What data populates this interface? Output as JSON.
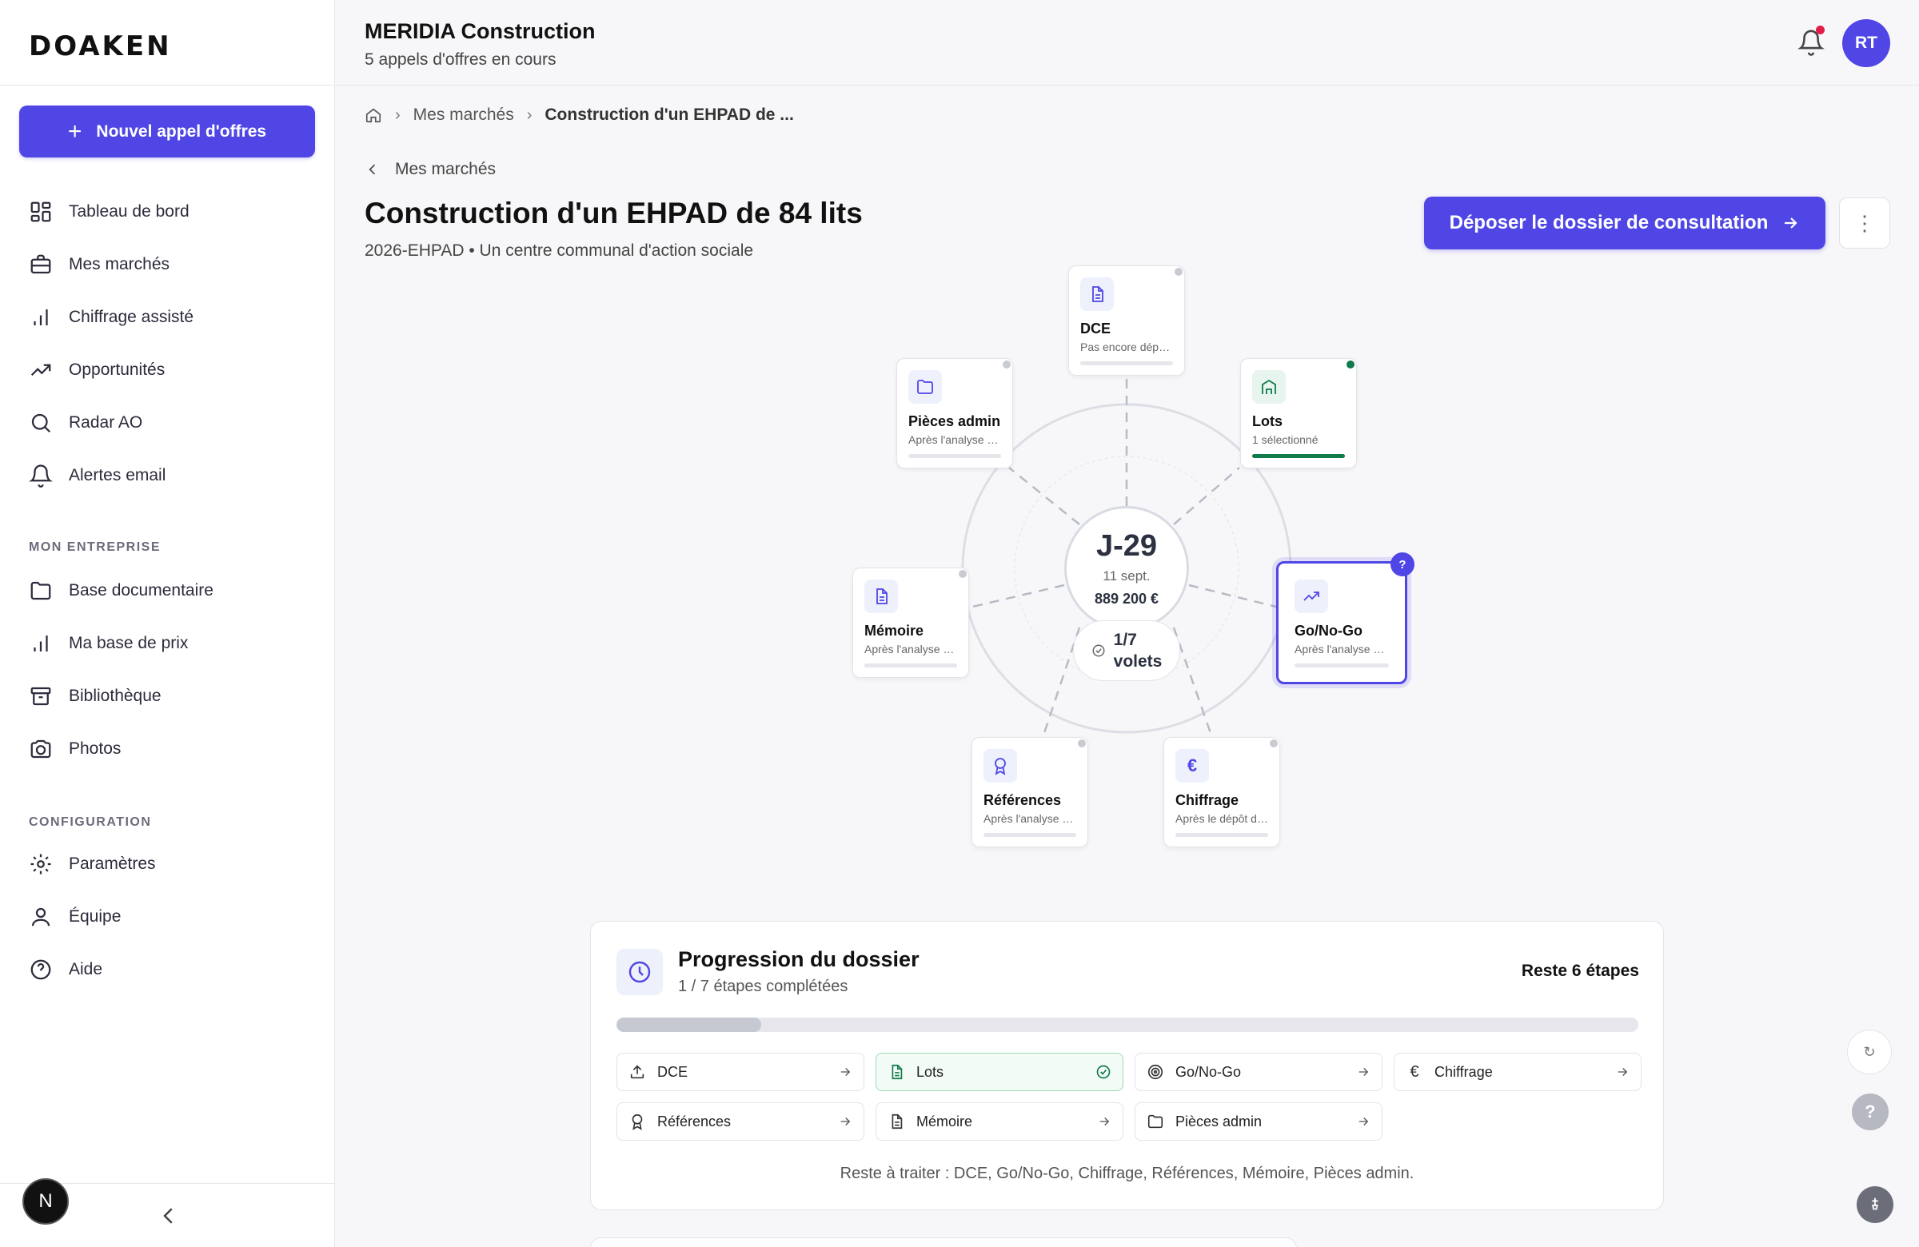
{
  "app": {
    "logo": "DOAKEN"
  },
  "header": {
    "company": "MERIDIA Construction",
    "subtitle": "5 appels d'offres en cours",
    "avatar_initials": "RT"
  },
  "sidebar": {
    "new_button": "Nouvel appel d'offres",
    "items": [
      {
        "label": "Tableau de bord",
        "icon": "dashboard-icon"
      },
      {
        "label": "Mes marchés",
        "icon": "briefcase-icon"
      },
      {
        "label": "Chiffrage assisté",
        "icon": "bar-chart-icon"
      },
      {
        "label": "Opportunités",
        "icon": "trending-up-icon"
      },
      {
        "label": "Radar AO",
        "icon": "search-icon"
      },
      {
        "label": "Alertes email",
        "icon": "bell-icon"
      }
    ],
    "section_company": "MON ENTREPRISE",
    "company_items": [
      {
        "label": "Base documentaire",
        "icon": "folder-icon"
      },
      {
        "label": "Ma base de prix",
        "icon": "bar-chart-icon"
      },
      {
        "label": "Bibliothèque",
        "icon": "archive-icon"
      },
      {
        "label": "Photos",
        "icon": "camera-icon"
      }
    ],
    "section_config": "CONFIGURATION",
    "config_items": [
      {
        "label": "Paramètres",
        "icon": "gear-icon"
      },
      {
        "label": "Équipe",
        "icon": "user-icon"
      },
      {
        "label": "Aide",
        "icon": "help-icon"
      }
    ],
    "bottom_badge": "N"
  },
  "breadcrumb": {
    "parent": "Mes marchés",
    "current": "Construction d'un EHPAD de ..."
  },
  "page": {
    "back": "Mes marchés",
    "title": "Construction d'un EHPAD de 84 lits",
    "subtitle": "2026-EHPAD • Un centre communal d'action sociale",
    "deposit_button": "Déposer le dossier de consultation",
    "more": "⋮"
  },
  "diagram": {
    "countdown": "J-29",
    "date": "11 sept.",
    "amount": "889 200 €",
    "volets_count": "1/7",
    "volets_label": "volets",
    "cards": {
      "dce": {
        "title": "DCE",
        "status": "Pas encore déposé"
      },
      "pieces": {
        "title": "Pièces admin",
        "status": "Après l'analyse du DCE"
      },
      "lots": {
        "title": "Lots",
        "status": "1 sélectionné"
      },
      "memoire": {
        "title": "Mémoire",
        "status": "Après l'analyse du DCE"
      },
      "gonogo": {
        "title": "Go/No-Go",
        "status": "Après l'analyse du DCE",
        "badge": "?"
      },
      "references": {
        "title": "Références",
        "status": "Après l'analyse du DCE"
      },
      "chiffrage": {
        "title": "Chiffrage",
        "status": "Après le dépôt du DCE"
      }
    }
  },
  "progress": {
    "title": "Progression du dossier",
    "subtitle": "1 / 7 étapes complétées",
    "remaining": "Reste 6 étapes",
    "fraction_complete": 0.142,
    "steps": [
      {
        "label": "DCE",
        "done": false
      },
      {
        "label": "Lots",
        "done": true
      },
      {
        "label": "Go/No-Go",
        "done": false
      },
      {
        "label": "Chiffrage",
        "done": false
      },
      {
        "label": "Références",
        "done": false
      },
      {
        "label": "Mémoire",
        "done": false
      },
      {
        "label": "Pièces admin",
        "done": false
      }
    ],
    "footer": "Reste à traiter : DCE, Go/No-Go, Chiffrage, Références, Mémoire, Pièces admin."
  },
  "floating": {
    "refresh": "↻",
    "help": "?"
  },
  "colors": {
    "accent": "#4f46e5",
    "success": "#0f7a4a",
    "alert": "#e11d48"
  }
}
